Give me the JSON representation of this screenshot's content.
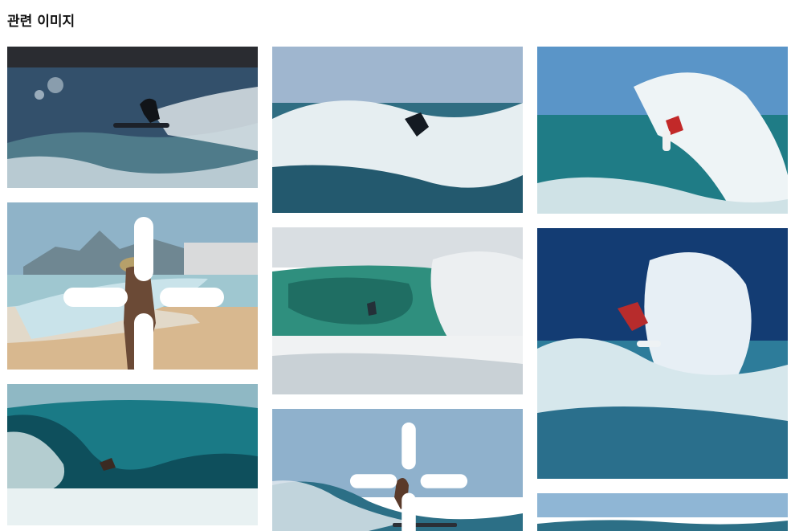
{
  "section": {
    "title": "관련 이미지"
  },
  "images": [
    {
      "id": "surfer-dark-silhouette",
      "badge": false
    },
    {
      "id": "beach-woman-surfboard",
      "badge": true
    },
    {
      "id": "barrel-wave-surfer",
      "badge": false
    },
    {
      "id": "surfer-big-spray",
      "badge": false
    },
    {
      "id": "surfer-inside-green-tube",
      "badge": false
    },
    {
      "id": "woman-surfer-longboard",
      "badge": true
    },
    {
      "id": "surfer-red-top-turquoise",
      "badge": false
    },
    {
      "id": "surfer-red-deep-blue-spray",
      "badge": false
    },
    {
      "id": "wave-partial",
      "badge": false
    }
  ],
  "icons": {
    "badge": "sparkle-badge-icon"
  }
}
